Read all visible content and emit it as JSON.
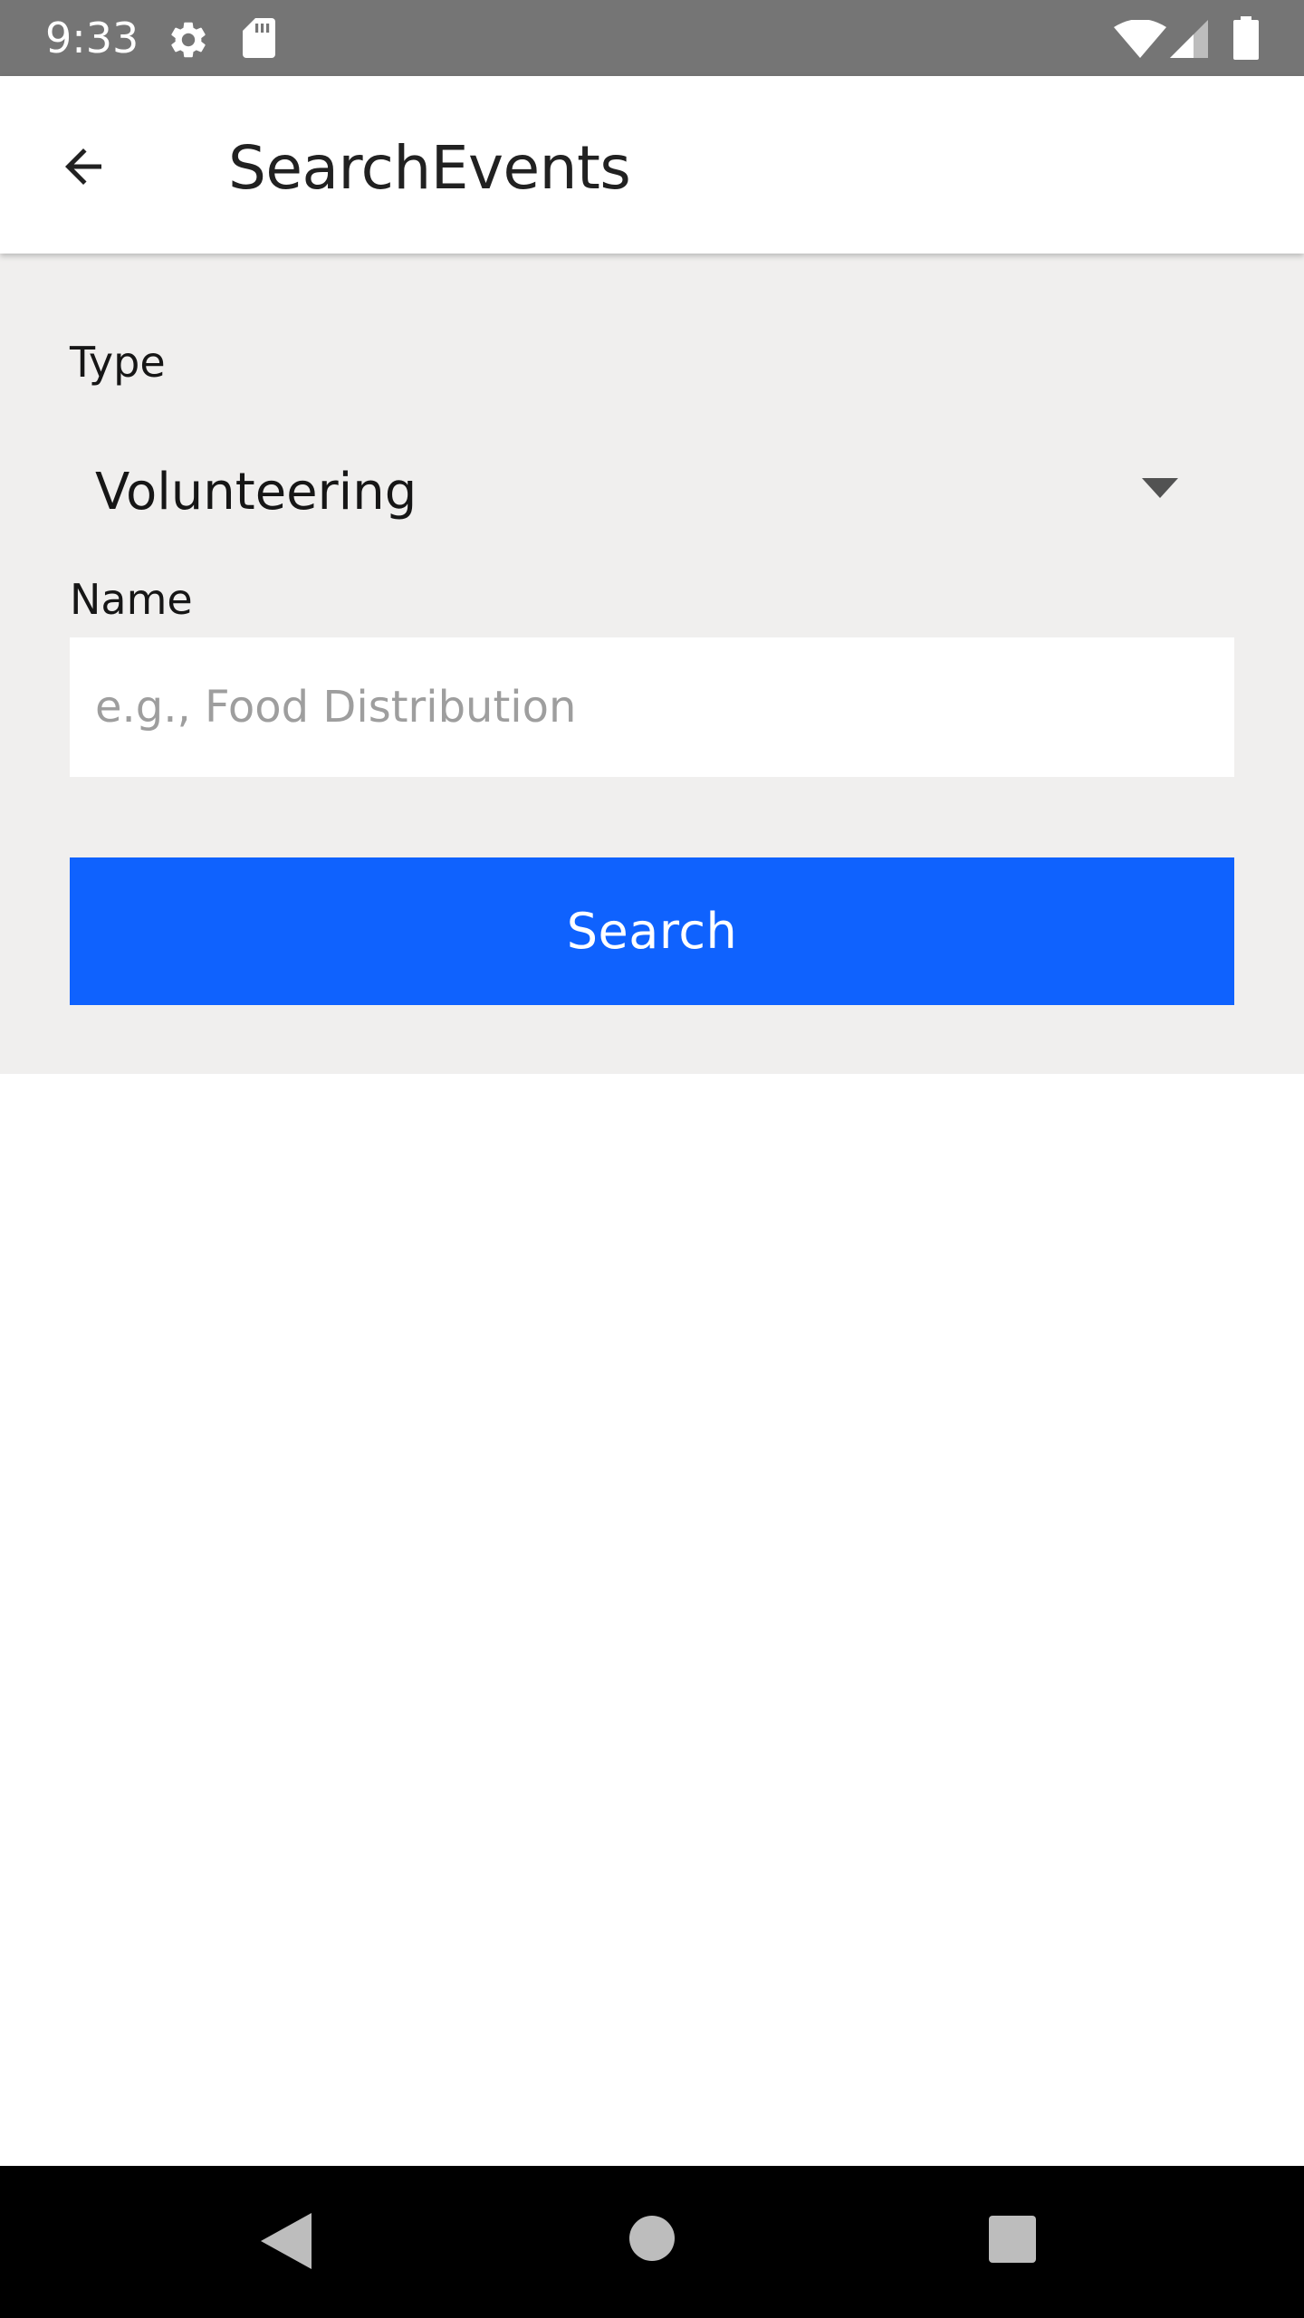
{
  "status_bar": {
    "time": "9:33",
    "icons": [
      "gear-icon",
      "sd-card-icon",
      "wifi-icon",
      "signal-icon",
      "battery-icon"
    ],
    "background": "#757575"
  },
  "app_bar": {
    "back_icon": "arrow-back-icon",
    "title": "SearchEvents"
  },
  "form": {
    "type_label": "Type",
    "type_selected": "Volunteering",
    "type_dropdown_icon": "chevron-down-icon",
    "name_label": "Name",
    "name_value": "",
    "name_placeholder": "e.g., Food Distribution",
    "search_button_label": "Search",
    "background": "#f0efee"
  },
  "colors": {
    "accent": "#0f62fe",
    "text_primary": "#161616",
    "placeholder": "#9e9e9e"
  },
  "nav_bar": {
    "icons": [
      "nav-back-icon",
      "nav-home-icon",
      "nav-recents-icon"
    ]
  }
}
